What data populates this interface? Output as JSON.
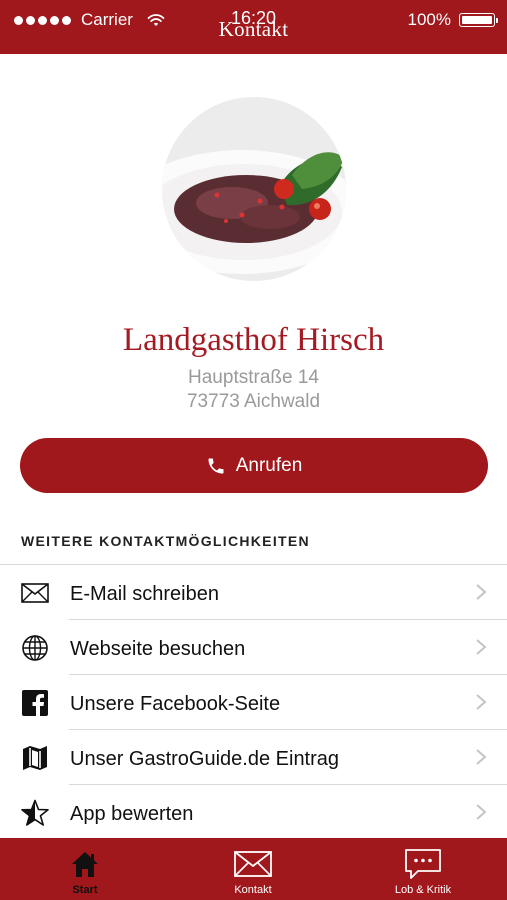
{
  "status_bar": {
    "carrier": "Carrier",
    "time": "16:20",
    "battery": "100%"
  },
  "nav": {
    "title": "Kontakt"
  },
  "restaurant": {
    "name": "Landgasthof Hirsch",
    "street": "Hauptstraße 14",
    "city": "73773 Aichwald"
  },
  "call_button": {
    "label": "Anrufen",
    "icon": "phone-icon"
  },
  "section": {
    "title": "WEITERE KONTAKTMÖGLICHKEITEN"
  },
  "contact_options": [
    {
      "label": "E-Mail schreiben",
      "icon": "envelope-icon"
    },
    {
      "label": "Webseite besuchen",
      "icon": "globe-icon"
    },
    {
      "label": "Unsere Facebook-Seite",
      "icon": "facebook-icon"
    },
    {
      "label": "Unser GastroGuide.de Eintrag",
      "icon": "map-icon"
    },
    {
      "label": "App bewerten",
      "icon": "star-icon"
    }
  ],
  "tabs": [
    {
      "label": "Start",
      "icon": "home-icon",
      "active": true
    },
    {
      "label": "Kontakt",
      "icon": "envelope-icon",
      "active": false
    },
    {
      "label": "Lob & Kritik",
      "icon": "speech-bubble-icon",
      "active": false
    }
  ],
  "colors": {
    "brand": "#a0171c",
    "name_text": "#a41a22",
    "address_text": "#9a9a9a"
  }
}
